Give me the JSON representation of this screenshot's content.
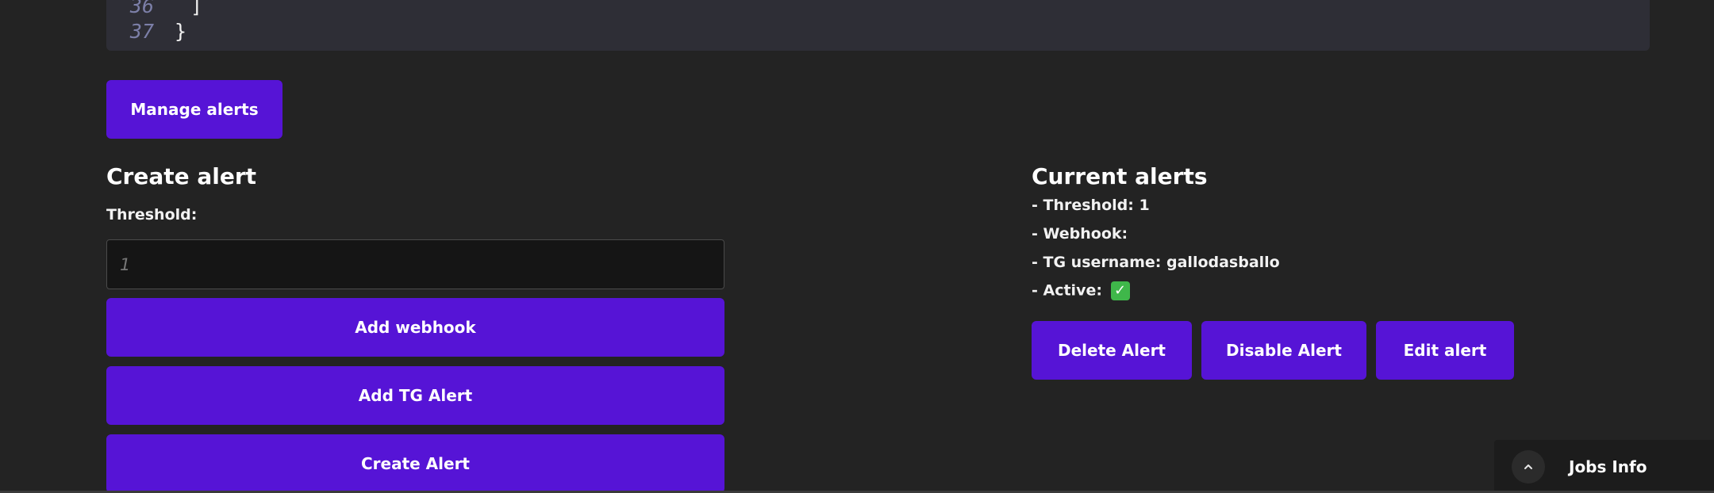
{
  "code": {
    "lines": [
      {
        "num": "36",
        "text": "]"
      },
      {
        "num": "37",
        "text": "}"
      }
    ]
  },
  "manage_alerts_button": "Manage alerts",
  "create_alert": {
    "title": "Create alert",
    "threshold_label": "Threshold:",
    "threshold_value": "",
    "threshold_placeholder": "1",
    "add_webhook_button": "Add webhook",
    "add_tg_alert_button": "Add TG Alert",
    "create_alert_button": "Create Alert"
  },
  "current_alerts": {
    "title": "Current alerts",
    "threshold": "- Threshold: 1",
    "webhook": "- Webhook:",
    "tg_username": "- TG username: gallodasballo",
    "active_label": "- Active:",
    "active_icon": "check-mark-emoji",
    "active_icon_glyph": "✓",
    "delete_button": "Delete Alert",
    "disable_button": "Disable Alert",
    "edit_button": "Edit alert"
  },
  "jobs_panel": {
    "label": "Jobs Info",
    "toggle_icon": "chevron-up-icon"
  },
  "colors": {
    "background": "#232323",
    "code_background": "#2e2e36",
    "accent": "#5614d6",
    "input_background": "#151515",
    "check_green": "#3fb74a"
  }
}
